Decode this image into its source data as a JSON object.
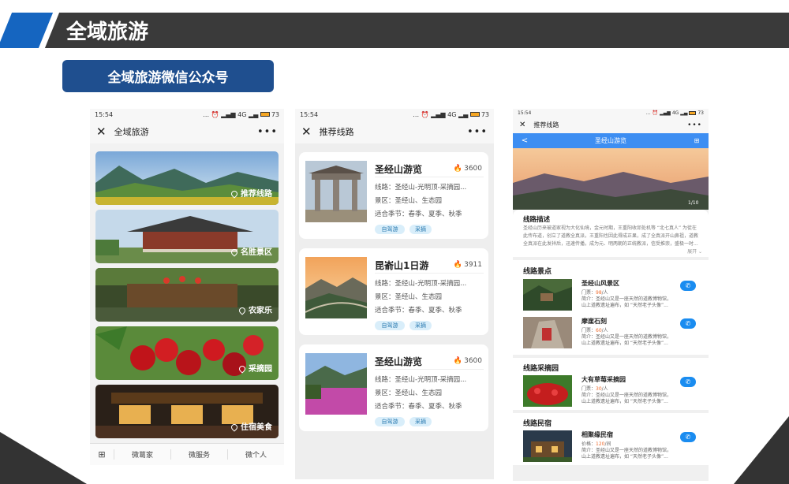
{
  "slide": {
    "title": "全域旅游",
    "subtitle": "全域旅游微信公众号"
  },
  "status": {
    "time": "15:54",
    "network": "4G",
    "battery": "73",
    "dots": "..."
  },
  "phone1": {
    "nav_close": "✕",
    "nav_title": "全域旅游",
    "nav_more": "•••",
    "tiles": [
      {
        "label": "推荐线路"
      },
      {
        "label": "名胜景区"
      },
      {
        "label": "农家乐"
      },
      {
        "label": "采摘园"
      },
      {
        "label": "住宿美食"
      }
    ],
    "tabs": {
      "keyboard": "⊞",
      "t1": "微葛家",
      "t2": "微服务",
      "t3": "微个人"
    }
  },
  "phone2": {
    "nav_close": "✕",
    "nav_title": "推荐线路",
    "nav_more": "•••",
    "cards": [
      {
        "name": "圣经山游览",
        "heat": "3600",
        "route": "线路：圣经山-光明顶-采摘园...",
        "scenic": "景区：圣经山、生态园",
        "season": "适合季节：春季、夏季、秋季",
        "tag1": "自驾游",
        "tag2": "采摘"
      },
      {
        "name": "昆嵛山1日游",
        "heat": "3911",
        "route": "线路：圣经山-光明顶-采摘园...",
        "scenic": "景区：圣经山、生态园",
        "season": "适合季节：春季、夏季、秋季",
        "tag1": "自驾游",
        "tag2": "采摘"
      },
      {
        "name": "圣经山游览",
        "heat": "3600",
        "route": "线路：圣经山-光明顶-采摘园...",
        "scenic": "景区：圣经山、生态园",
        "season": "适合季节：春季、夏季、秋季",
        "tag1": "自驾游",
        "tag2": "采摘"
      }
    ]
  },
  "phone3": {
    "nav_close": "✕",
    "nav_title": "推荐线路",
    "nav_more": "•••",
    "blue_back": "<",
    "blue_title": "圣经山游览",
    "blue_icon": "⊞",
    "banner_counter": "1/10",
    "desc_title": "线路描述",
    "desc_text": "圣经山历来被道家视为大化仙境，金元时期，王重阳收邱处机等 “北七真人” 为徒在此传布道，创立了道教全真派，王重阳也因此得成正果，成了全真派开山鼻祖，道教全真派在此发祥后，迅速传播，成为元、明两朝的正统教派，信受推崇，盛极一时...",
    "desc_more": "展开 ⌄",
    "sections": [
      {
        "title": "线路景点",
        "items": [
          {
            "name": "圣经山风景区",
            "price_label": "门票：",
            "price": "98",
            "unit": "/人",
            "d1": "简介：圣经山又是一座天然的道教博物馆，",
            "d2": "山上道教遗址遍布，如 “天然老子头像”..."
          },
          {
            "name": "摩崖石刻",
            "price_label": "门票：",
            "price": "60",
            "unit": "/人",
            "d1": "简介：圣经山又是一座天然的道教博物馆，",
            "d2": "山上道教遗址遍布，如 “天然老子头像”..."
          }
        ]
      },
      {
        "title": "线路采摘园",
        "items": [
          {
            "name": "大有草莓采摘园",
            "price_label": "门票：",
            "price": "30",
            "unit": "/人",
            "d1": "简介：圣经山又是一座天然的道教博物馆，",
            "d2": "山上道教遗址遍布，如 “天然老子头像”..."
          }
        ]
      },
      {
        "title": "线路民宿",
        "items": [
          {
            "name": "相聚缘民宿",
            "price_label": "价格：",
            "price": "120",
            "unit": "/间",
            "d1": "简介：圣经山又是一座天然的道教博物馆，",
            "d2": "山上道教遗址遍布，如 “天然老子头像”..."
          }
        ]
      }
    ],
    "phone_icon": "✆"
  },
  "colors": {
    "accent_blue": "#1a8cf0",
    "header_dark": "#3a3a3a",
    "pill_blue": "#1f4f8f",
    "heat_orange": "#ff6b2c"
  }
}
